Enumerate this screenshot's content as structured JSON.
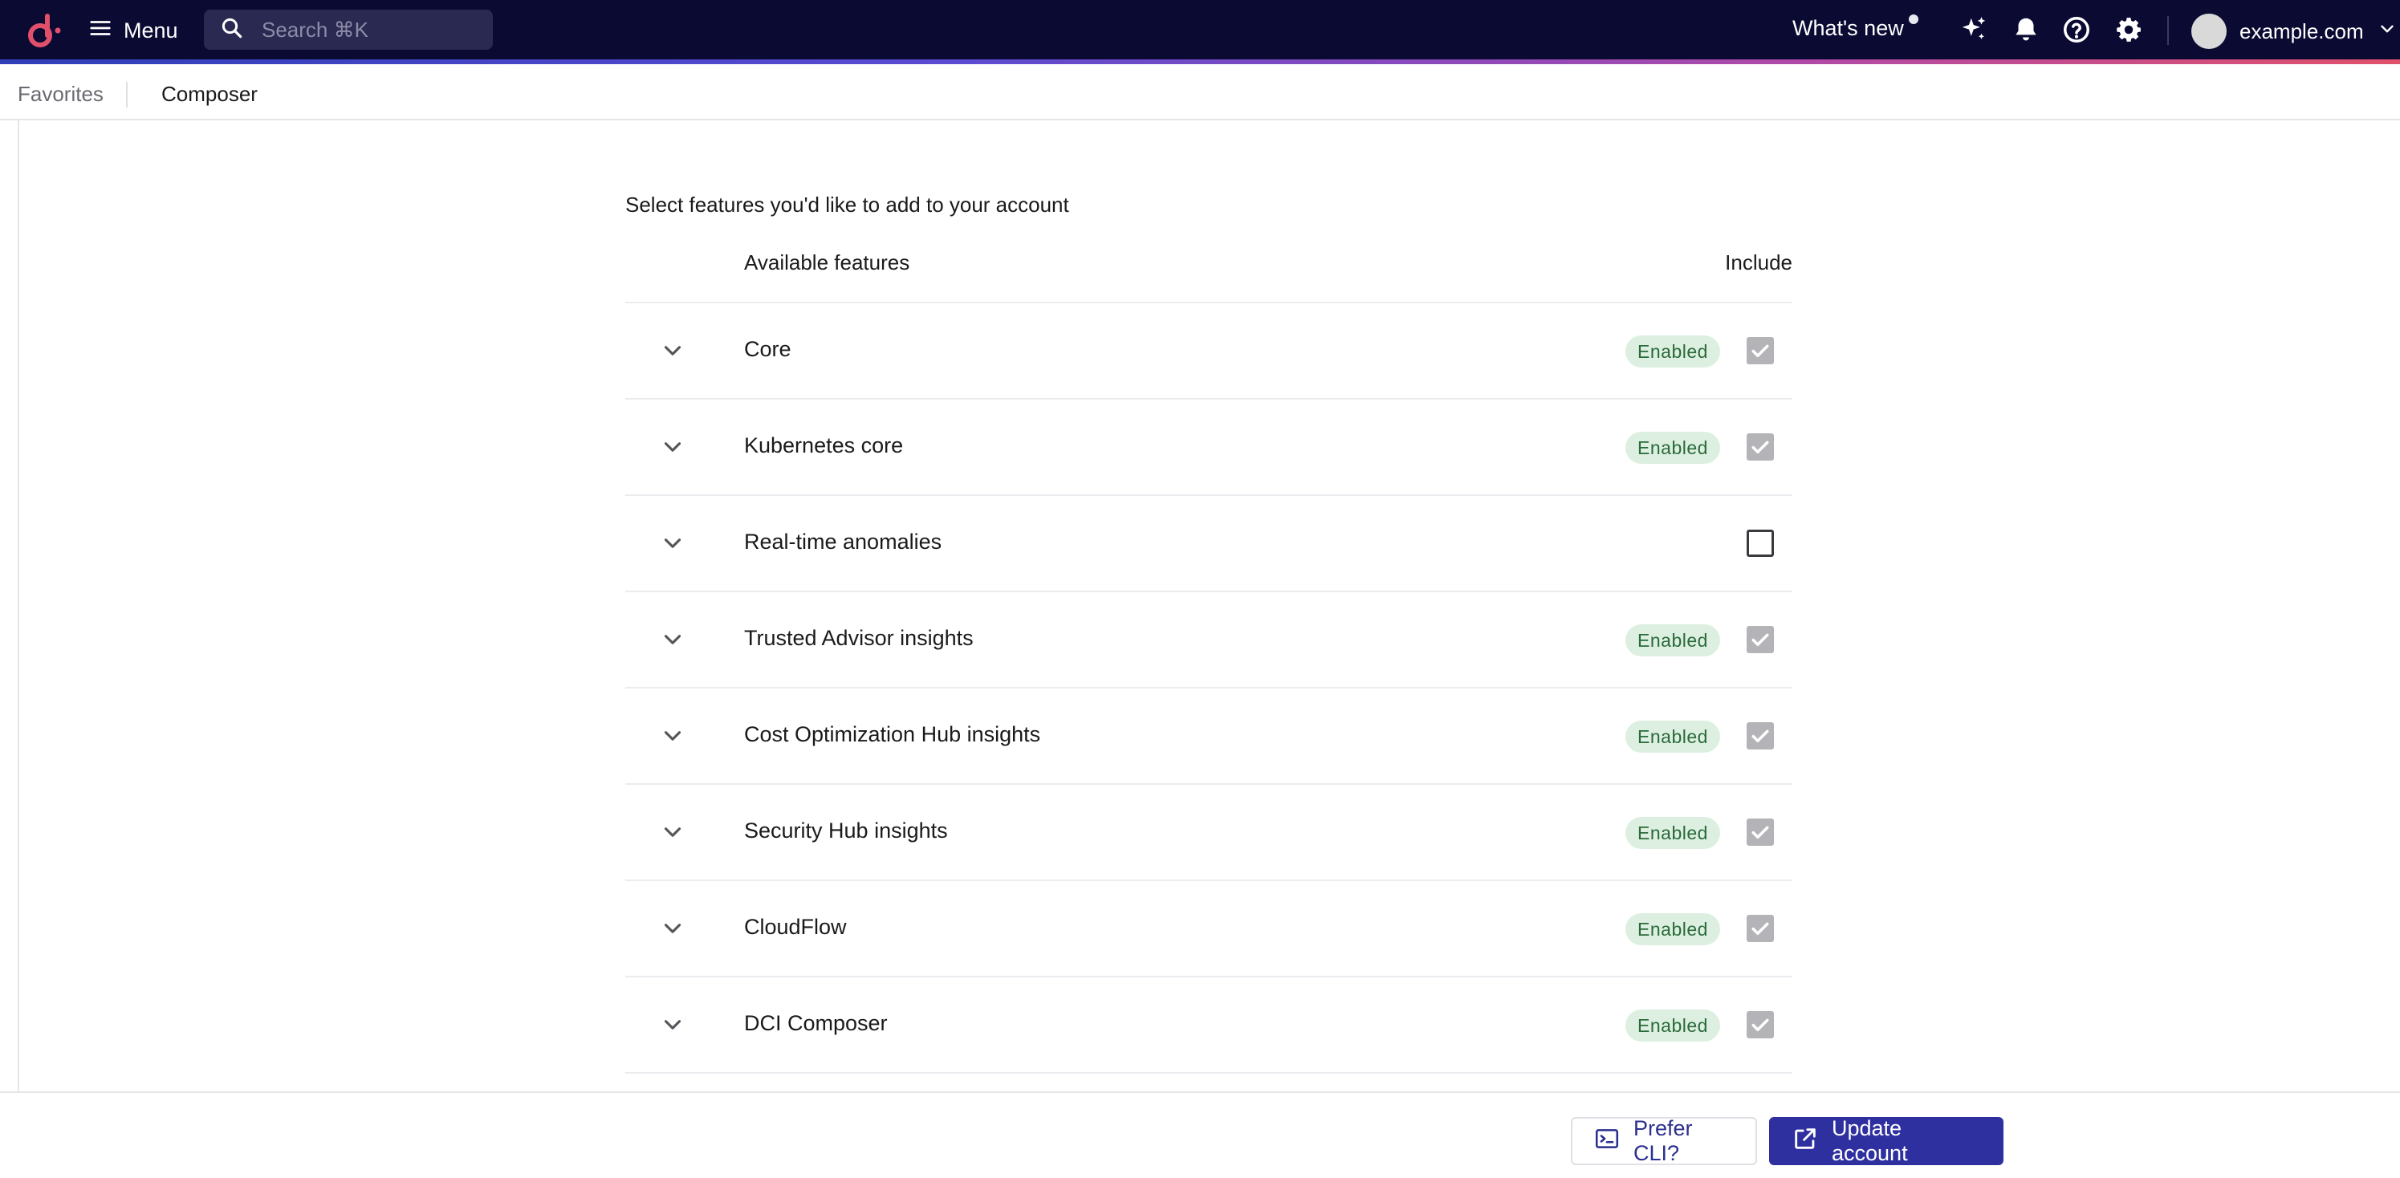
{
  "topbar": {
    "menu_label": "Menu",
    "search_placeholder": "Search ⌘K",
    "whats_new_label": "What's new",
    "user_label": "example.com",
    "colors": {
      "background": "#0b0a33",
      "accent_start": "#2f3fb8",
      "accent_end": "#e0506a",
      "logo": "#e0506a"
    }
  },
  "breadcrumb": {
    "items": [
      "Favorites",
      "Composer"
    ]
  },
  "main": {
    "section_title": "Select features you'd like to add to your account",
    "columns": {
      "features": "Available features",
      "include": "Include"
    },
    "rows": [
      {
        "name": "Core",
        "status": "Enabled",
        "included": true
      },
      {
        "name": "Kubernetes core",
        "status": "Enabled",
        "included": true
      },
      {
        "name": "Real-time anomalies",
        "status": "",
        "included": false
      },
      {
        "name": "Trusted Advisor insights",
        "status": "Enabled",
        "included": true
      },
      {
        "name": "Cost Optimization Hub insights",
        "status": "Enabled",
        "included": true
      },
      {
        "name": "Security Hub insights",
        "status": "Enabled",
        "included": true
      },
      {
        "name": "CloudFlow",
        "status": "Enabled",
        "included": true
      },
      {
        "name": "DCI Composer",
        "status": "Enabled",
        "included": true
      }
    ],
    "colors": {
      "badge_bg": "#dcefe0",
      "badge_text": "#2b6a3a"
    }
  },
  "footer": {
    "cli_label": "Prefer CLI?",
    "update_label": "Update account",
    "colors": {
      "primary": "#2f30a0"
    }
  }
}
